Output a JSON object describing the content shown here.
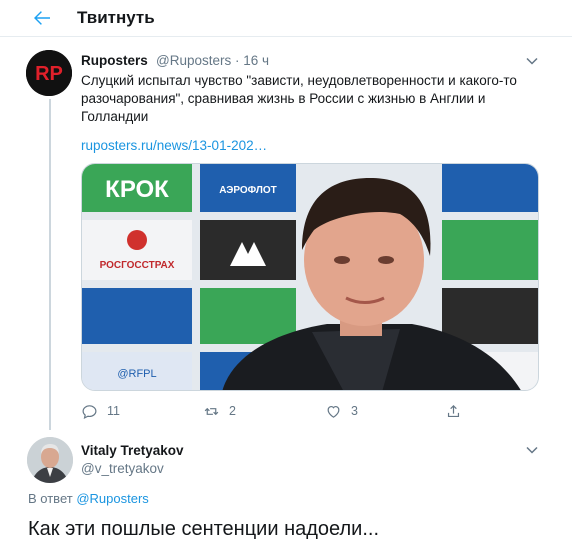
{
  "header": {
    "title": "Твитнуть",
    "back_icon": "arrow-left-icon"
  },
  "tweet": {
    "avatar_text": "RP",
    "author_name": "Ruposters",
    "author_handle": "@Ruposters",
    "separator": "·",
    "time": "16 ч",
    "text": "Слуцкий испытал чувство \"зависти, неудовлетворенности и какого-то разочарования\", сравнивая жизнь в России с жизнью в Англии и Голландии",
    "link": "ruposters.ru/news/13-01-202…",
    "media_backdrop_words": [
      "КРОК",
      "АЭРОФЛОТ",
      "РОСГОССТРАХ",
      "@RFPL"
    ],
    "actions": {
      "reply_count": "11",
      "retweet_count": "2",
      "like_count": "3"
    }
  },
  "reply": {
    "author_name": "Vitaly Tretyakov",
    "author_handle": "@v_tretyakov",
    "in_reply_prefix": "В ответ",
    "in_reply_user": "@Ruposters",
    "text": "Как эти пошлые сентенции надоели..."
  },
  "colors": {
    "accent": "#1b95e0",
    "muted": "#657786",
    "border": "#e6ecf0",
    "thread": "#ccd6dd"
  }
}
